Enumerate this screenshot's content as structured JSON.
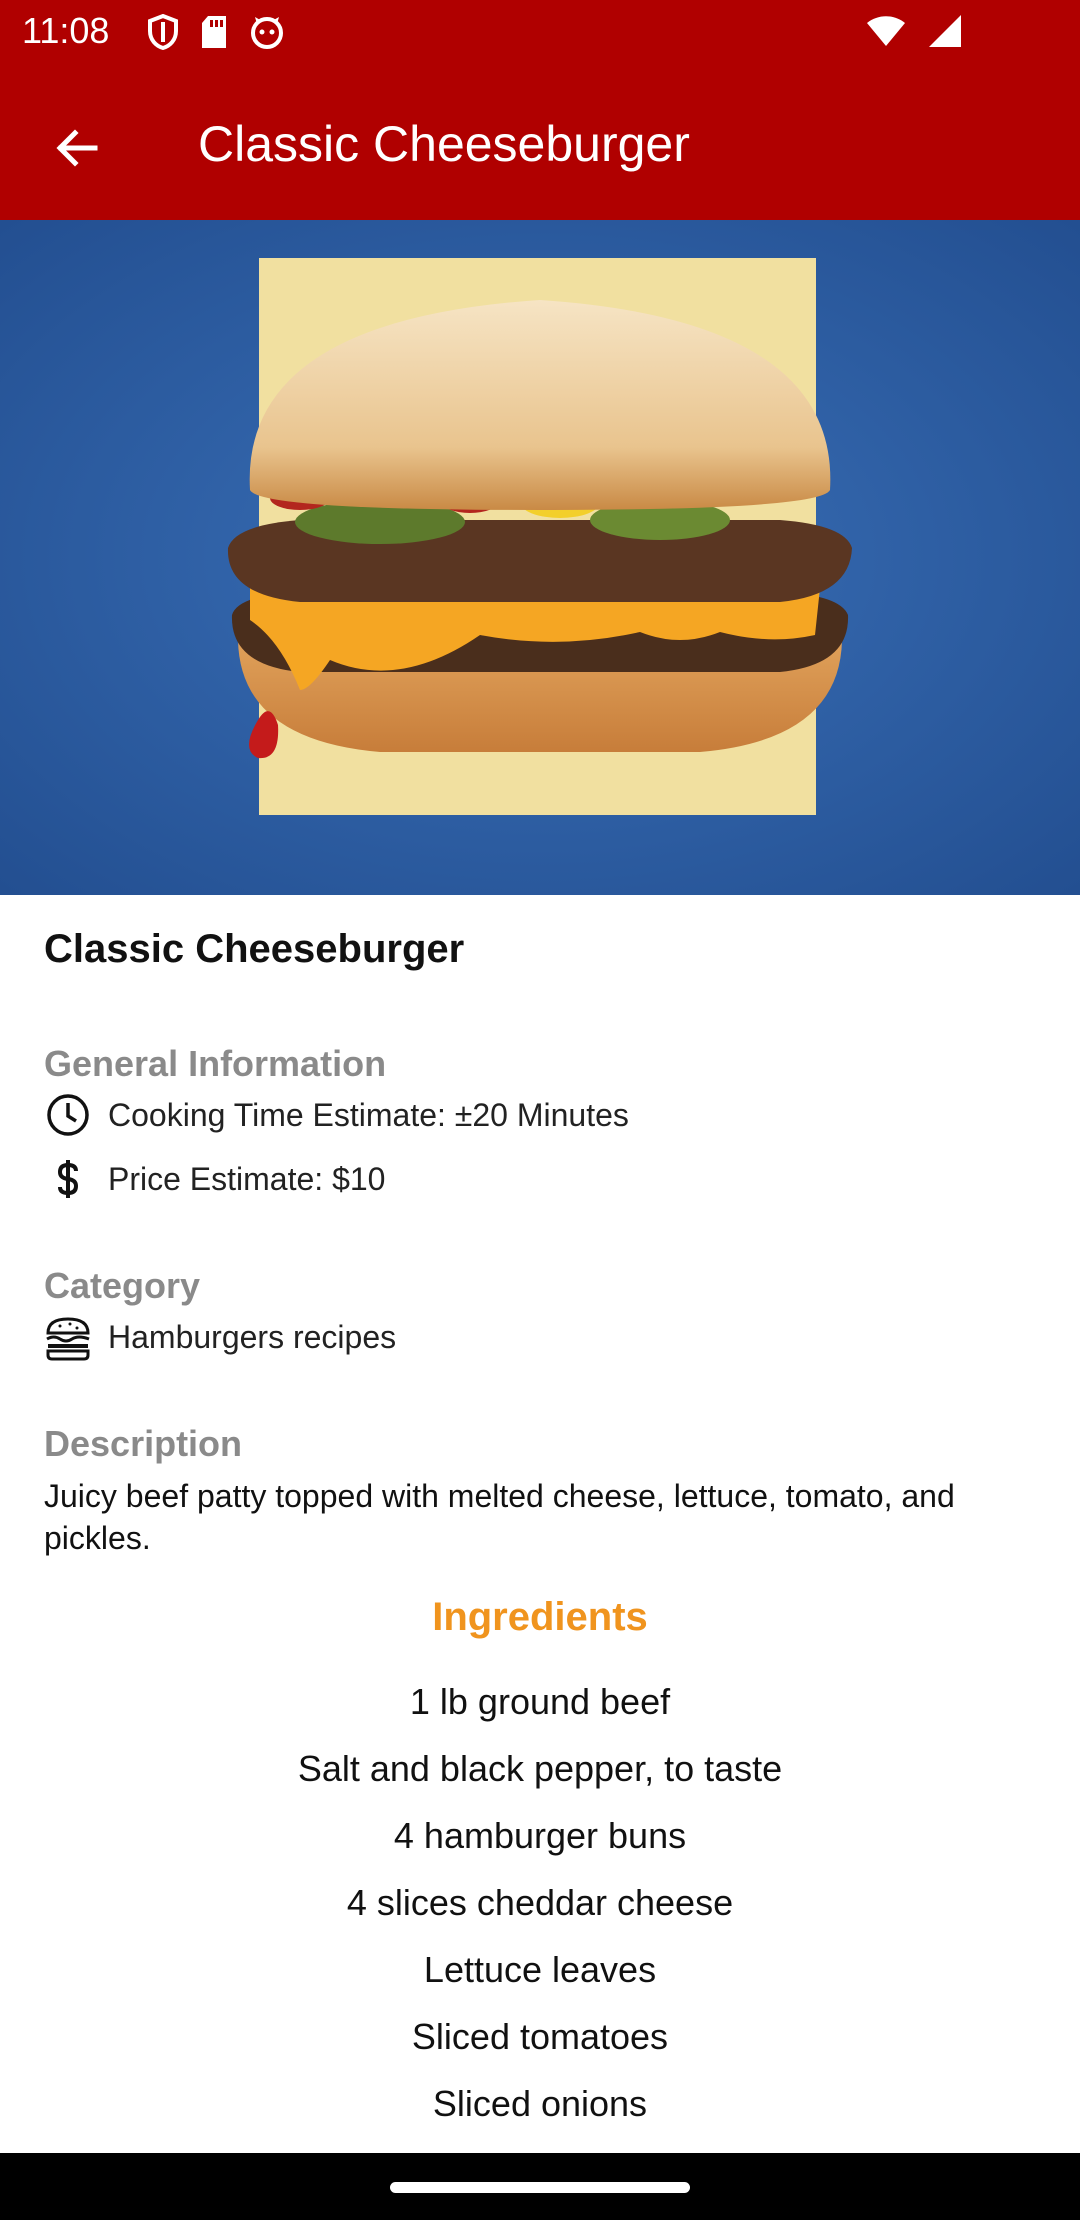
{
  "status_bar": {
    "time": "11:08",
    "left_icons": [
      "shield-icon",
      "sd-card-icon",
      "face-icon"
    ],
    "right_icons": [
      "wifi-icon",
      "signal-icon"
    ]
  },
  "app_bar": {
    "back_icon": "arrow-back-icon",
    "title": "Classic Cheeseburger",
    "color": "#b00000"
  },
  "hero": {
    "image": "cheeseburger-photo"
  },
  "recipe": {
    "title": "Classic Cheeseburger",
    "general_info_label": "General Information",
    "cooking_time": "Cooking Time Estimate: ±20 Minutes",
    "cooking_time_icon": "clock-icon",
    "price": "Price Estimate: $10",
    "price_icon": "dollar-icon",
    "category_label": "Category",
    "category": "Hamburgers recipes",
    "category_icon": "burger-icon",
    "description_label": "Description",
    "description": "Juicy beef patty topped with melted cheese, lettuce, tomato, and pickles.",
    "ingredients_label": "Ingredients",
    "ingredients_color": "#f0941e",
    "ingredients": [
      "1 lb ground beef",
      "Salt and black pepper, to taste",
      "4 hamburger buns",
      "4 slices cheddar cheese",
      "Lettuce leaves",
      "Sliced tomatoes",
      "Sliced onions"
    ]
  }
}
